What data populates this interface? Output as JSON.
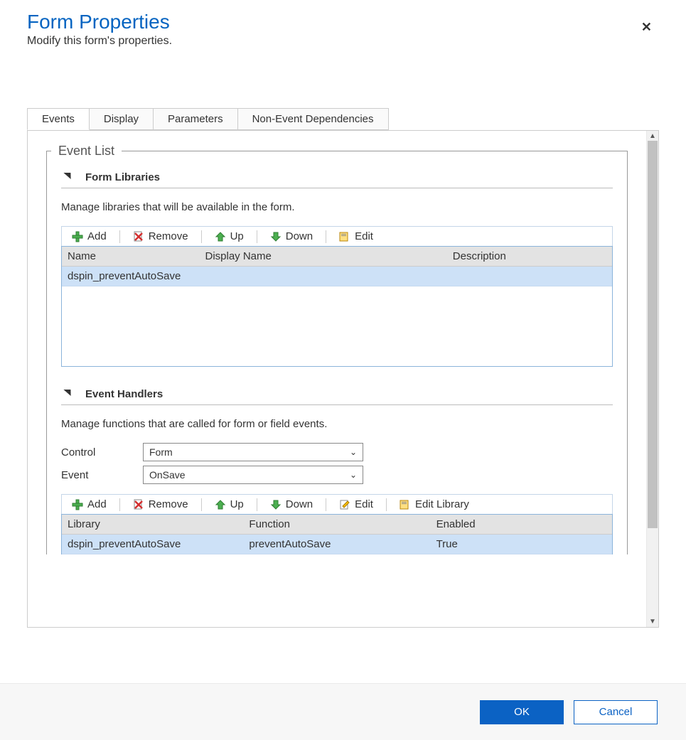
{
  "title": "Form Properties",
  "subtitle": "Modify this form's properties.",
  "tabs": [
    {
      "label": "Events",
      "active": true
    },
    {
      "label": "Display"
    },
    {
      "label": "Parameters"
    },
    {
      "label": "Non-Event Dependencies"
    }
  ],
  "eventList": {
    "legend": "Event List",
    "formLibraries": {
      "title": "Form Libraries",
      "desc": "Manage libraries that will be available in the form.",
      "toolbar": {
        "add": "Add",
        "remove": "Remove",
        "up": "Up",
        "down": "Down",
        "edit": "Edit"
      },
      "columns": {
        "name": "Name",
        "displayName": "Display Name",
        "description": "Description"
      },
      "rows": [
        {
          "name": "dspin_preventAutoSave",
          "displayName": "",
          "description": ""
        }
      ]
    },
    "eventHandlers": {
      "title": "Event Handlers",
      "desc": "Manage functions that are called for form or field events.",
      "controlLabel": "Control",
      "controlValue": "Form",
      "eventLabel": "Event",
      "eventValue": "OnSave",
      "toolbar": {
        "add": "Add",
        "remove": "Remove",
        "up": "Up",
        "down": "Down",
        "edit": "Edit",
        "editLibrary": "Edit Library"
      },
      "columns": {
        "library": "Library",
        "function": "Function",
        "enabled": "Enabled"
      },
      "rows": [
        {
          "library": "dspin_preventAutoSave",
          "function": "preventAutoSave",
          "enabled": "True"
        }
      ]
    }
  },
  "footer": {
    "ok": "OK",
    "cancel": "Cancel"
  }
}
